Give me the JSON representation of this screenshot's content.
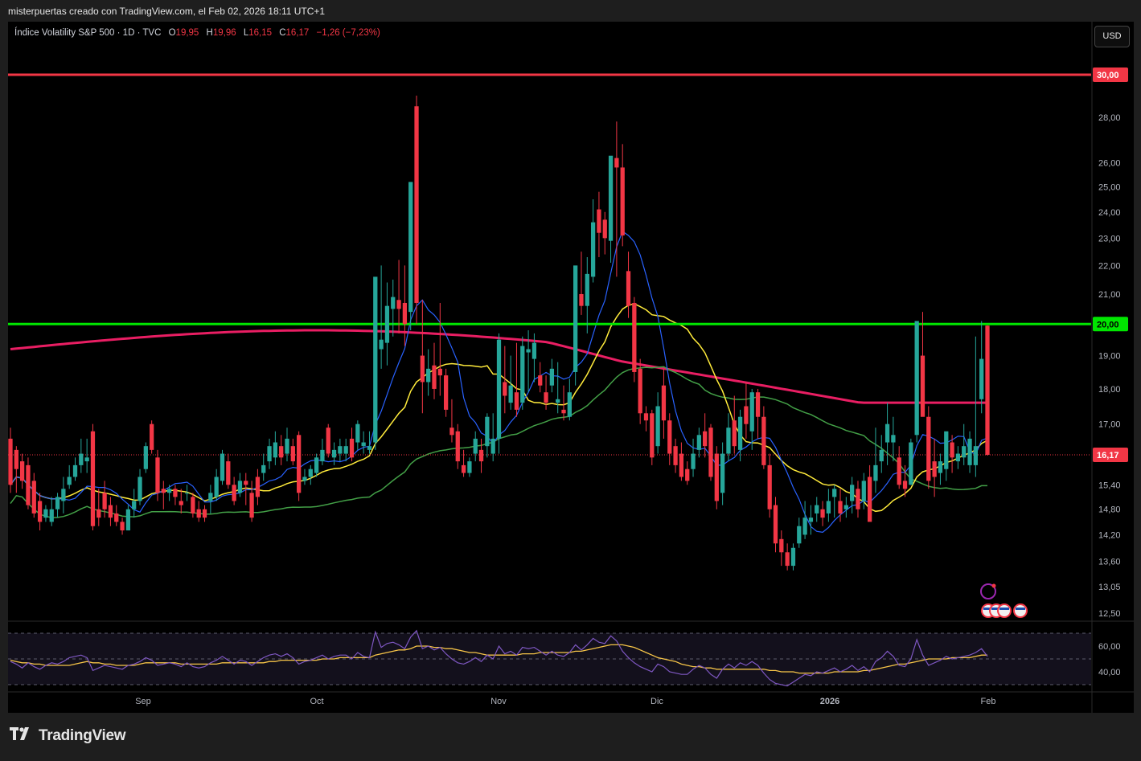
{
  "header": {
    "caption": "misterpuertas creado con TradingView.com, el Feb 02, 2026 18:11 UTC+1"
  },
  "legend": {
    "symbol": "Índice Volatility S&P 500 · 1D · TVC",
    "o_label": "O",
    "o_value": "19,95",
    "h_label": "H",
    "h_value": "19,96",
    "l_label": "L",
    "l_value": "16,15",
    "c_label": "C",
    "c_value": "16,17",
    "change": "−1,26 (−7,23%)"
  },
  "currency_button": "USD",
  "footer": {
    "brand": "TradingView"
  },
  "colors": {
    "up": "#26a69a",
    "down": "#f23645",
    "resistance": "#f23645",
    "support": "#00e600",
    "ma_fast": "#2962ff",
    "ma_20": "#ffeb3b",
    "ma_50": "#43a047",
    "ma_200": "#e91e63",
    "rsi": "#7e57c2",
    "rsi_ma": "#f7c548"
  },
  "chart_data": {
    "type": "candlestick",
    "scale": "log",
    "price_axis": {
      "ticks": [
        "12,50",
        "13,05",
        "13,60",
        "14,20",
        "14,80",
        "15,40",
        "17,00",
        "18,00",
        "19,00",
        "21,00",
        "22,00",
        "23,00",
        "24,00",
        "25,00",
        "26,00",
        "28,00"
      ],
      "ylim": [
        12.3,
        31.5
      ]
    },
    "time_axis": {
      "labels": [
        "Sep",
        "Oct",
        "Nov",
        "Dic",
        "2026",
        "Feb"
      ]
    },
    "horizontal_lines": [
      {
        "value": 30.0,
        "label": "30,00",
        "color": "#f23645"
      },
      {
        "value": 20.0,
        "label": "20,00",
        "color": "#00e600"
      }
    ],
    "last_price": {
      "value": 16.17,
      "label": "16,17"
    },
    "candles": [
      [
        16.6,
        16.9,
        15.2,
        15.4
      ],
      [
        16.3,
        16.4,
        15.2,
        15.8
      ],
      [
        16.0,
        16.2,
        15.3,
        15.5
      ],
      [
        15.9,
        16.1,
        14.8,
        14.9
      ],
      [
        15.5,
        15.7,
        14.6,
        14.7
      ],
      [
        15.0,
        15.2,
        14.3,
        14.5
      ],
      [
        14.6,
        14.9,
        14.5,
        14.8
      ],
      [
        14.5,
        15.1,
        14.4,
        14.8
      ],
      [
        14.8,
        15.2,
        14.6,
        15.1
      ],
      [
        15.0,
        15.6,
        14.7,
        15.3
      ],
      [
        15.4,
        15.9,
        15.3,
        15.6
      ],
      [
        15.6,
        16.1,
        15.5,
        15.9
      ],
      [
        15.9,
        16.6,
        15.7,
        16.2
      ],
      [
        16.0,
        16.6,
        15.7,
        16.1
      ],
      [
        16.8,
        17.0,
        14.3,
        14.4
      ],
      [
        14.8,
        15.3,
        14.4,
        14.6
      ],
      [
        15.2,
        15.5,
        14.6,
        14.8
      ],
      [
        14.9,
        15.1,
        14.4,
        14.6
      ],
      [
        14.7,
        14.9,
        14.4,
        14.5
      ],
      [
        14.5,
        14.6,
        14.2,
        14.3
      ],
      [
        14.3,
        14.9,
        14.3,
        14.8
      ],
      [
        14.8,
        15.3,
        14.6,
        15.0
      ],
      [
        15.0,
        15.8,
        14.9,
        15.6
      ],
      [
        15.8,
        16.5,
        15.7,
        16.4
      ],
      [
        17.0,
        17.1,
        16.2,
        16.3
      ],
      [
        16.1,
        16.3,
        15.0,
        15.2
      ],
      [
        15.3,
        15.5,
        14.8,
        15.2
      ],
      [
        15.2,
        15.4,
        15.0,
        15.3
      ],
      [
        15.3,
        15.4,
        14.9,
        15.1
      ],
      [
        15.0,
        15.3,
        14.7,
        14.9
      ],
      [
        15.2,
        15.4,
        15.0,
        15.2
      ],
      [
        15.1,
        15.2,
        14.6,
        14.7
      ],
      [
        14.8,
        15.0,
        14.5,
        14.6
      ],
      [
        14.8,
        14.9,
        14.5,
        14.6
      ],
      [
        15.0,
        15.4,
        14.7,
        15.2
      ],
      [
        15.1,
        15.8,
        15.0,
        15.6
      ],
      [
        15.5,
        16.3,
        15.4,
        16.2
      ],
      [
        16.0,
        16.2,
        15.3,
        15.4
      ],
      [
        15.4,
        15.6,
        14.9,
        15.0
      ],
      [
        15.2,
        15.7,
        15.1,
        15.5
      ],
      [
        15.5,
        15.7,
        14.9,
        15.4
      ],
      [
        15.2,
        15.5,
        14.5,
        14.6
      ],
      [
        15.6,
        15.8,
        14.9,
        15.1
      ],
      [
        15.7,
        16.2,
        15.5,
        15.9
      ],
      [
        16.0,
        16.6,
        15.8,
        16.4
      ],
      [
        16.1,
        16.8,
        15.9,
        16.5
      ],
      [
        16.4,
        16.7,
        15.9,
        16.1
      ],
      [
        16.2,
        16.9,
        16.0,
        16.6
      ],
      [
        16.4,
        16.6,
        15.9,
        16.0
      ],
      [
        16.7,
        16.8,
        15.0,
        15.2
      ],
      [
        15.5,
        15.8,
        15.4,
        15.6
      ],
      [
        15.6,
        15.9,
        15.4,
        15.8
      ],
      [
        15.7,
        16.2,
        15.6,
        16.1
      ],
      [
        16.0,
        16.6,
        15.9,
        16.3
      ],
      [
        16.9,
        17.0,
        16.1,
        16.2
      ],
      [
        16.1,
        16.5,
        15.9,
        16.3
      ],
      [
        16.2,
        16.6,
        16.0,
        16.4
      ],
      [
        16.2,
        16.6,
        16.0,
        16.4
      ],
      [
        16.6,
        16.9,
        16.0,
        16.1
      ],
      [
        16.5,
        17.1,
        16.3,
        17.0
      ],
      [
        16.4,
        16.8,
        16.2,
        16.5
      ],
      [
        16.3,
        16.8,
        16.2,
        16.4
      ],
      [
        16.5,
        17.3,
        16.3,
        21.6
      ],
      [
        19.2,
        22.0,
        18.6,
        19.5
      ],
      [
        19.4,
        21.4,
        18.7,
        20.6
      ],
      [
        20.5,
        21.5,
        19.6,
        20.9
      ],
      [
        20.8,
        22.2,
        19.7,
        20.5
      ],
      [
        20.7,
        22.0,
        19.3,
        20.0
      ],
      [
        20.4,
        22.3,
        19.8,
        25.2
      ],
      [
        28.5,
        29.0,
        20.0,
        20.7
      ],
      [
        19.0,
        20.8,
        17.3,
        18.2
      ],
      [
        18.2,
        19.2,
        17.8,
        18.6
      ],
      [
        18.7,
        19.4,
        17.7,
        18.0
      ],
      [
        18.6,
        20.7,
        17.8,
        18.4
      ],
      [
        18.4,
        18.6,
        17.2,
        17.4
      ],
      [
        16.9,
        17.7,
        16.5,
        16.7
      ],
      [
        16.8,
        17.0,
        15.8,
        16.0
      ],
      [
        15.9,
        16.3,
        15.6,
        15.7
      ],
      [
        15.7,
        16.1,
        15.6,
        16.0
      ],
      [
        16.2,
        16.8,
        16.0,
        16.6
      ],
      [
        16.3,
        16.6,
        15.7,
        16.0
      ],
      [
        16.4,
        17.3,
        16.1,
        17.2
      ],
      [
        16.2,
        17.3,
        16.0,
        16.6
      ],
      [
        16.6,
        19.7,
        16.2,
        19.5
      ],
      [
        18.2,
        19.3,
        17.3,
        17.8
      ],
      [
        17.6,
        19.0,
        17.4,
        18.1
      ],
      [
        17.9,
        19.4,
        17.2,
        17.4
      ],
      [
        17.6,
        19.6,
        17.4,
        19.3
      ],
      [
        19.1,
        19.8,
        17.9,
        19.2
      ],
      [
        18.9,
        19.7,
        18.2,
        19.4
      ],
      [
        18.4,
        18.8,
        17.9,
        18.1
      ],
      [
        17.9,
        18.4,
        17.4,
        17.6
      ],
      [
        18.1,
        18.9,
        17.9,
        18.6
      ],
      [
        17.6,
        18.8,
        17.3,
        17.7
      ],
      [
        17.4,
        18.1,
        17.1,
        17.3
      ],
      [
        17.2,
        18.3,
        17.1,
        17.9
      ],
      [
        18.5,
        21.0,
        18.1,
        22.0
      ],
      [
        21.0,
        22.5,
        20.3,
        20.6
      ],
      [
        20.6,
        22.3,
        19.7,
        21.7
      ],
      [
        21.6,
        24.5,
        21.4,
        23.6
      ],
      [
        24.1,
        24.8,
        22.3,
        23.2
      ],
      [
        23.7,
        24.0,
        22.4,
        23.0
      ],
      [
        22.9,
        25.4,
        22.1,
        26.3
      ],
      [
        26.2,
        27.8,
        21.6,
        25.8
      ],
      [
        25.8,
        26.8,
        22.7,
        23.1
      ],
      [
        21.8,
        22.5,
        20.2,
        20.6
      ],
      [
        20.7,
        20.9,
        18.2,
        18.5
      ],
      [
        18.6,
        18.9,
        17.0,
        17.3
      ],
      [
        17.3,
        17.5,
        16.8,
        17.1
      ],
      [
        17.3,
        17.4,
        15.9,
        16.1
      ],
      [
        16.4,
        17.9,
        16.2,
        17.5
      ],
      [
        18.1,
        18.6,
        16.6,
        17.1
      ],
      [
        17.1,
        17.3,
        15.9,
        16.2
      ],
      [
        16.4,
        16.6,
        15.7,
        15.9
      ],
      [
        16.2,
        16.5,
        15.5,
        15.6
      ],
      [
        15.8,
        16.0,
        15.4,
        15.5
      ],
      [
        15.8,
        16.6,
        15.6,
        16.2
      ],
      [
        16.3,
        16.9,
        16.1,
        16.7
      ],
      [
        16.8,
        17.3,
        16.1,
        16.4
      ],
      [
        16.9,
        17.0,
        15.5,
        15.6
      ],
      [
        16.2,
        16.4,
        14.8,
        15.0
      ],
      [
        15.2,
        16.5,
        14.9,
        16.2
      ],
      [
        16.2,
        17.3,
        16.0,
        16.9
      ],
      [
        17.1,
        17.8,
        16.2,
        16.4
      ],
      [
        16.3,
        17.4,
        16.0,
        17.2
      ],
      [
        17.5,
        18.2,
        16.6,
        17.0
      ],
      [
        16.8,
        18.0,
        16.3,
        17.9
      ],
      [
        17.9,
        18.0,
        16.6,
        17.2
      ],
      [
        17.2,
        17.5,
        15.8,
        15.9
      ],
      [
        15.9,
        16.2,
        14.6,
        14.8
      ],
      [
        14.9,
        15.1,
        13.8,
        14.0
      ],
      [
        14.1,
        14.3,
        13.5,
        13.8
      ],
      [
        13.8,
        14.0,
        13.4,
        13.5
      ],
      [
        13.5,
        14.0,
        13.4,
        13.9
      ],
      [
        14.0,
        14.6,
        13.9,
        14.4
      ],
      [
        14.2,
        15.0,
        14.1,
        14.6
      ],
      [
        14.5,
        14.9,
        14.2,
        14.6
      ],
      [
        14.7,
        15.1,
        14.5,
        14.9
      ],
      [
        14.8,
        15.0,
        14.4,
        14.6
      ],
      [
        14.7,
        15.3,
        14.5,
        15.0
      ],
      [
        15.1,
        15.4,
        14.6,
        15.3
      ],
      [
        15.0,
        15.3,
        14.5,
        14.7
      ],
      [
        14.8,
        15.1,
        14.6,
        14.9
      ],
      [
        15.0,
        15.6,
        14.7,
        15.4
      ],
      [
        15.3,
        15.5,
        14.6,
        14.8
      ],
      [
        15.0,
        15.7,
        14.8,
        15.5
      ],
      [
        15.6,
        15.9,
        14.6,
        14.5
      ],
      [
        15.5,
        16.9,
        15.2,
        15.9
      ],
      [
        16.0,
        16.7,
        15.7,
        16.3
      ],
      [
        16.5,
        17.6,
        15.9,
        17.0
      ],
      [
        16.5,
        17.2,
        16.0,
        16.7
      ],
      [
        16.1,
        16.4,
        15.3,
        15.4
      ],
      [
        15.5,
        15.9,
        15.1,
        15.3
      ],
      [
        15.4,
        16.6,
        15.4,
        16.5
      ],
      [
        16.7,
        20.1,
        16.5,
        20.1
      ],
      [
        19.0,
        20.4,
        17.5,
        17.2
      ],
      [
        17.2,
        17.5,
        15.3,
        15.5
      ],
      [
        16.0,
        16.6,
        15.1,
        15.6
      ],
      [
        15.7,
        16.2,
        15.4,
        16.0
      ],
      [
        15.8,
        16.7,
        15.5,
        16.8
      ],
      [
        16.5,
        16.7,
        15.7,
        16.1
      ],
      [
        16.0,
        16.4,
        15.8,
        16.2
      ],
      [
        16.1,
        17.0,
        15.9,
        16.4
      ],
      [
        15.9,
        16.8,
        15.7,
        16.6
      ],
      [
        15.9,
        19.6,
        15.6,
        16.4
      ],
      [
        17.7,
        20.1,
        17.3,
        18.9
      ],
      [
        19.95,
        19.96,
        16.15,
        16.17
      ]
    ],
    "moving_averages_visible": 4,
    "rsi_panel": {
      "ticks": [
        "60,00",
        "40,00"
      ],
      "upper": 70,
      "mid": 50,
      "lower": 30,
      "rsi": [
        48,
        46,
        43,
        47,
        44,
        42,
        45,
        47,
        46,
        48,
        51,
        52,
        53,
        51,
        41,
        43,
        45,
        44,
        43,
        42,
        45,
        46,
        48,
        51,
        49,
        45,
        46,
        47,
        46,
        44,
        47,
        44,
        43,
        44,
        47,
        49,
        52,
        49,
        46,
        49,
        48,
        45,
        48,
        51,
        53,
        54,
        52,
        54,
        51,
        46,
        48,
        49,
        51,
        53,
        50,
        52,
        53,
        53,
        50,
        55,
        52,
        51,
        71,
        59,
        62,
        63,
        61,
        58,
        67,
        72,
        58,
        60,
        57,
        59,
        54,
        50,
        47,
        46,
        48,
        51,
        48,
        53,
        50,
        60,
        54,
        56,
        53,
        59,
        58,
        59,
        56,
        53,
        56,
        53,
        52,
        55,
        61,
        57,
        61,
        66,
        63,
        62,
        68,
        64,
        56,
        51,
        47,
        44,
        42,
        40,
        46,
        44,
        40,
        39,
        38,
        38,
        42,
        45,
        43,
        38,
        35,
        42,
        46,
        43,
        47,
        45,
        48,
        45,
        39,
        34,
        31,
        30,
        29,
        32,
        35,
        38,
        37,
        40,
        39,
        41,
        43,
        40,
        42,
        45,
        41,
        44,
        40,
        48,
        51,
        56,
        52,
        45,
        44,
        50,
        65,
        53,
        45,
        47,
        49,
        52,
        50,
        51,
        52,
        53,
        55,
        58,
        52
      ],
      "rsi_ma": [
        49,
        48,
        47,
        47,
        46,
        46,
        45,
        45,
        45,
        45,
        45,
        46,
        47,
        48,
        47,
        47,
        46,
        46,
        45,
        45,
        45,
        45,
        46,
        47,
        47,
        47,
        47,
        47,
        47,
        46,
        46,
        46,
        46,
        46,
        46,
        46,
        47,
        47,
        47,
        47,
        47,
        47,
        47,
        47,
        48,
        48,
        49,
        49,
        49,
        49,
        49,
        49,
        49,
        50,
        50,
        50,
        51,
        51,
        51,
        51,
        51,
        51,
        53,
        54,
        55,
        56,
        57,
        57,
        58,
        60,
        60,
        60,
        59,
        59,
        58,
        58,
        57,
        56,
        55,
        55,
        54,
        53,
        53,
        53,
        53,
        53,
        53,
        54,
        54,
        54,
        55,
        55,
        55,
        55,
        55,
        55,
        56,
        56,
        57,
        58,
        59,
        60,
        61,
        61,
        61,
        60,
        59,
        57,
        55,
        53,
        51,
        50,
        49,
        48,
        46,
        45,
        44,
        44,
        43,
        43,
        42,
        42,
        42,
        42,
        42,
        42,
        42,
        42,
        42,
        41,
        41,
        40,
        40,
        40,
        39,
        39,
        39,
        39,
        39,
        39,
        40,
        40,
        40,
        40,
        40,
        41,
        41,
        42,
        43,
        44,
        45,
        46,
        46,
        47,
        48,
        49,
        50,
        50,
        50,
        50,
        51,
        51,
        51,
        51,
        52,
        53,
        53
      ]
    }
  }
}
